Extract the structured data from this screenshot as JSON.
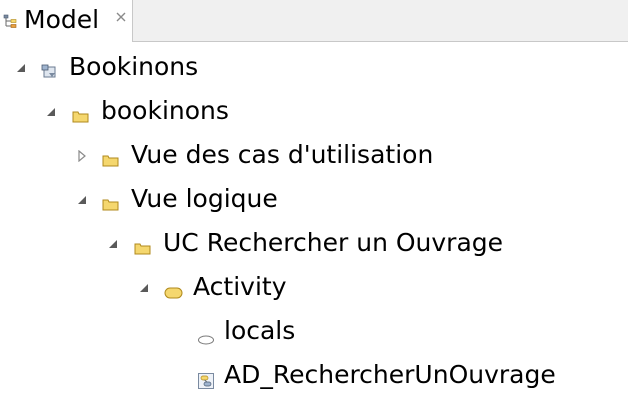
{
  "tab": {
    "title": "Model",
    "icon": "model-explorer-icon",
    "close_icon": "close-icon"
  },
  "tree": {
    "nodes": [
      {
        "label": "Bookinons",
        "icon": "model-package-icon",
        "state": "expanded"
      },
      {
        "label": "bookinons",
        "icon": "folder-icon",
        "state": "expanded"
      },
      {
        "label": "Vue des cas d'utilisation",
        "icon": "folder-icon",
        "state": "collapsed"
      },
      {
        "label": "Vue logique",
        "icon": "folder-icon",
        "state": "expanded"
      },
      {
        "label": "UC Rechercher un Ouvrage",
        "icon": "folder-icon",
        "state": "expanded"
      },
      {
        "label": "Activity",
        "icon": "activity-icon",
        "state": "expanded"
      },
      {
        "label": "locals",
        "icon": "locals-icon",
        "state": "leaf"
      },
      {
        "label": "AD_RechercherUnOuvrage",
        "icon": "activity-diagram-icon",
        "state": "leaf"
      }
    ]
  },
  "colors": {
    "folder_fill": "#f5d76e",
    "folder_stroke": "#b08a1c",
    "activity_fill": "#f5d76e",
    "tab_background": "#f0f0f0",
    "twisty": "#5a5a5a"
  }
}
